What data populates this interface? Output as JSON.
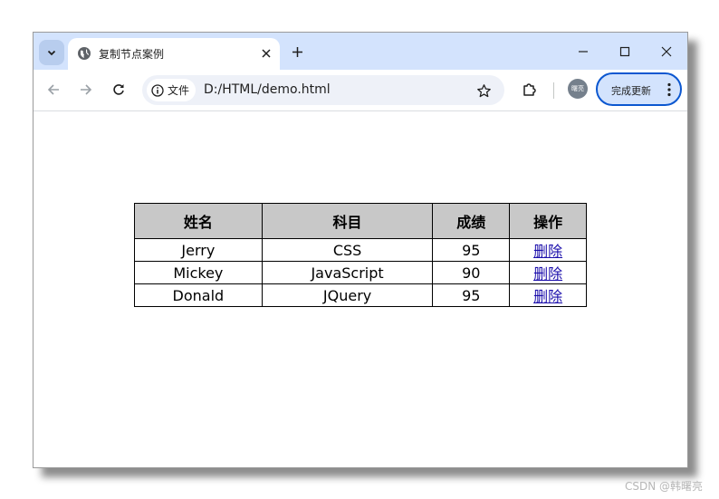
{
  "browser": {
    "tab": {
      "title": "复制节点案例"
    },
    "address": {
      "site_chip": "文件",
      "url": "D:/HTML/demo.html"
    },
    "profile": {
      "label": "曙亮"
    },
    "update_button": {
      "label": "完成更新"
    }
  },
  "table": {
    "headers": [
      "姓名",
      "科目",
      "成绩",
      "操作"
    ],
    "rows": [
      {
        "name": "Jerry",
        "subject": "CSS",
        "score": "95",
        "action": "删除"
      },
      {
        "name": "Mickey",
        "subject": "JavaScript",
        "score": "90",
        "action": "删除"
      },
      {
        "name": "Donald",
        "subject": "JQuery",
        "score": "95",
        "action": "删除"
      }
    ]
  },
  "watermark": "CSDN @韩曙亮",
  "colors": {
    "tab_strip": "#d3e3fd",
    "header_background": "#c8c8c8",
    "link": "#1a0dab",
    "update_border": "#0b57d0"
  }
}
